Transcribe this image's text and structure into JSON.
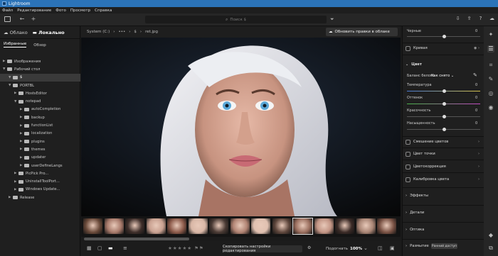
{
  "app": {
    "title": "Lightroom"
  },
  "menu": [
    "Файл",
    "Редактирование",
    "Фото",
    "Просмотр",
    "Справка"
  ],
  "search": {
    "placeholder": "Поиск $"
  },
  "left_panel": {
    "tabs": [
      {
        "label": "Облако"
      },
      {
        "label": "Локально"
      }
    ],
    "subtabs": [
      {
        "label": "Избранные"
      },
      {
        "label": "Обзор"
      }
    ],
    "tree": [
      {
        "label": "Изображения",
        "level": 0,
        "expanded": false
      },
      {
        "label": "Рабочий стол",
        "level": 0,
        "expanded": true
      },
      {
        "label": "$",
        "level": 1,
        "expanded": true,
        "selected": true
      },
      {
        "label": "PORTBL",
        "level": 1,
        "expanded": true
      },
      {
        "label": "HostsEditor",
        "level": 2,
        "expanded": false
      },
      {
        "label": "notepad",
        "level": 2,
        "expanded": true
      },
      {
        "label": "autoCompletion",
        "level": 3,
        "expanded": false
      },
      {
        "label": "backup",
        "level": 3,
        "expanded": false
      },
      {
        "label": "functionList",
        "level": 3,
        "expanded": false
      },
      {
        "label": "localization",
        "level": 3,
        "expanded": false
      },
      {
        "label": "plugins",
        "level": 3,
        "expanded": false
      },
      {
        "label": "themes",
        "level": 3,
        "expanded": false
      },
      {
        "label": "updater",
        "level": 3,
        "expanded": false
      },
      {
        "label": "userDefineLangs",
        "level": 3,
        "expanded": false
      },
      {
        "label": "PicPick Pro...",
        "level": 2,
        "expanded": false
      },
      {
        "label": "UninstallToolPort...",
        "level": 2,
        "expanded": false
      },
      {
        "label": "Windows Update...",
        "level": 2,
        "expanded": false
      },
      {
        "label": "Release",
        "level": 1,
        "expanded": false
      }
    ]
  },
  "breadcrumb": {
    "drive": "System (C:)",
    "more": "•••",
    "folder": "$",
    "file": "ret.jpg"
  },
  "sync_button": {
    "label": "Обновить правки в облаке"
  },
  "bottom": {
    "copy_settings": "Скопировать настройки редактирования",
    "fit_label": "Подогнать",
    "zoom": "100%"
  },
  "right_panel": {
    "blacks_label": "Черные",
    "blacks_value": "0",
    "curve_label": "Кривая",
    "color_header": "Цвет",
    "wb_label": "Баланс белого",
    "wb_value": "Как снято",
    "temp_label": "Температура",
    "temp_value": "0",
    "tint_label": "Оттенок",
    "tint_value": "0",
    "vibrance_label": "Красочность",
    "vibrance_value": "0",
    "saturation_label": "Насыщенность",
    "saturation_value": "0",
    "sections": [
      {
        "label": "Смешение цветов"
      },
      {
        "label": "Цвет точки"
      },
      {
        "label": "Цветокоррекция"
      },
      {
        "label": "Калибровка цвета"
      }
    ],
    "groups": [
      {
        "label": "Эффекты"
      },
      {
        "label": "Детали"
      },
      {
        "label": "Оптика"
      },
      {
        "label": "Размытие"
      }
    ],
    "access_badge": "Ранний доступ"
  },
  "colors": {
    "accent": "#2b73b8",
    "panel": "#1f1f1f",
    "bg": "#1a1a1a"
  }
}
